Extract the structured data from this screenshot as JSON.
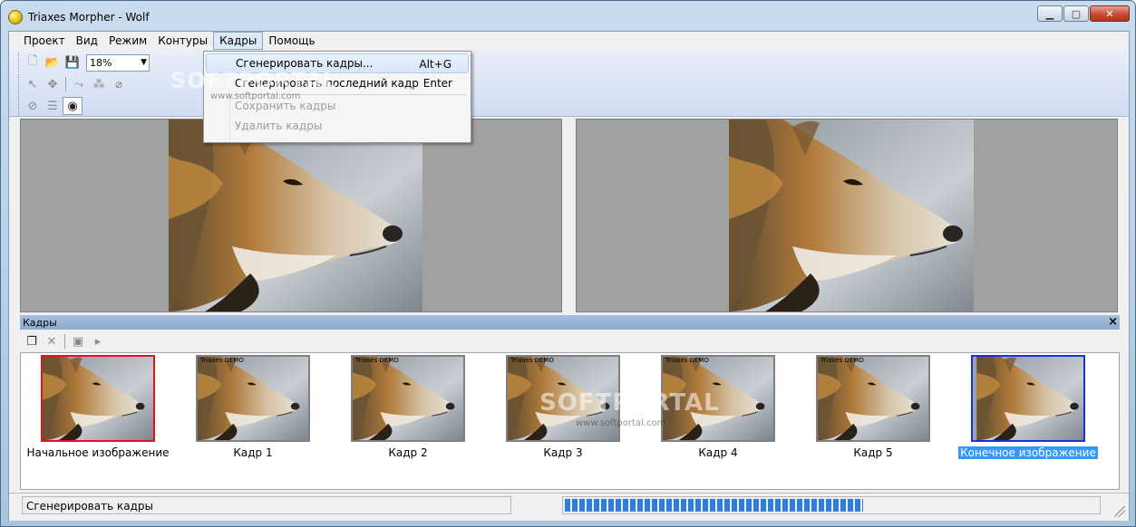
{
  "window": {
    "title": "Triaxes Morpher - Wolf"
  },
  "menubar": {
    "items": [
      "Проект",
      "Вид",
      "Режим",
      "Контуры",
      "Кадры",
      "Помощь"
    ]
  },
  "toolbar": {
    "zoom": "18%"
  },
  "frames_menu": {
    "items": [
      {
        "label": "Сгенерировать кадры...",
        "shortcut": "Alt+G"
      },
      {
        "label": "Сгенерировать последний кадр",
        "shortcut": "Enter"
      },
      {
        "label": "Сохранить кадры",
        "shortcut": ""
      },
      {
        "label": "Удалить кадры",
        "shortcut": ""
      }
    ]
  },
  "frames_panel": {
    "title": "Кадры",
    "close": "×",
    "thumbnails": [
      {
        "label": "Начальное изображение",
        "demo": ""
      },
      {
        "label": "Кадр 1",
        "demo": "Triaxes DEMO"
      },
      {
        "label": "Кадр 2",
        "demo": "Triaxes DEMO"
      },
      {
        "label": "Кадр 3",
        "demo": "Triaxes DEMO"
      },
      {
        "label": "Кадр 4",
        "demo": "Triaxes DEMO"
      },
      {
        "label": "Кадр 5",
        "demo": "Triaxes DEMO"
      },
      {
        "label": "Конечное изображение",
        "demo": ""
      }
    ]
  },
  "statusbar": {
    "text": "Сгенерировать кадры",
    "progress": 0.56
  },
  "watermark": {
    "brand": "SOFTPORTAL",
    "url": "www.softportal.com"
  },
  "colors": {
    "selection": "#3399ff",
    "progress": "#2f7de0",
    "start_border": "#e0141e",
    "end_border": "#1436d8"
  }
}
